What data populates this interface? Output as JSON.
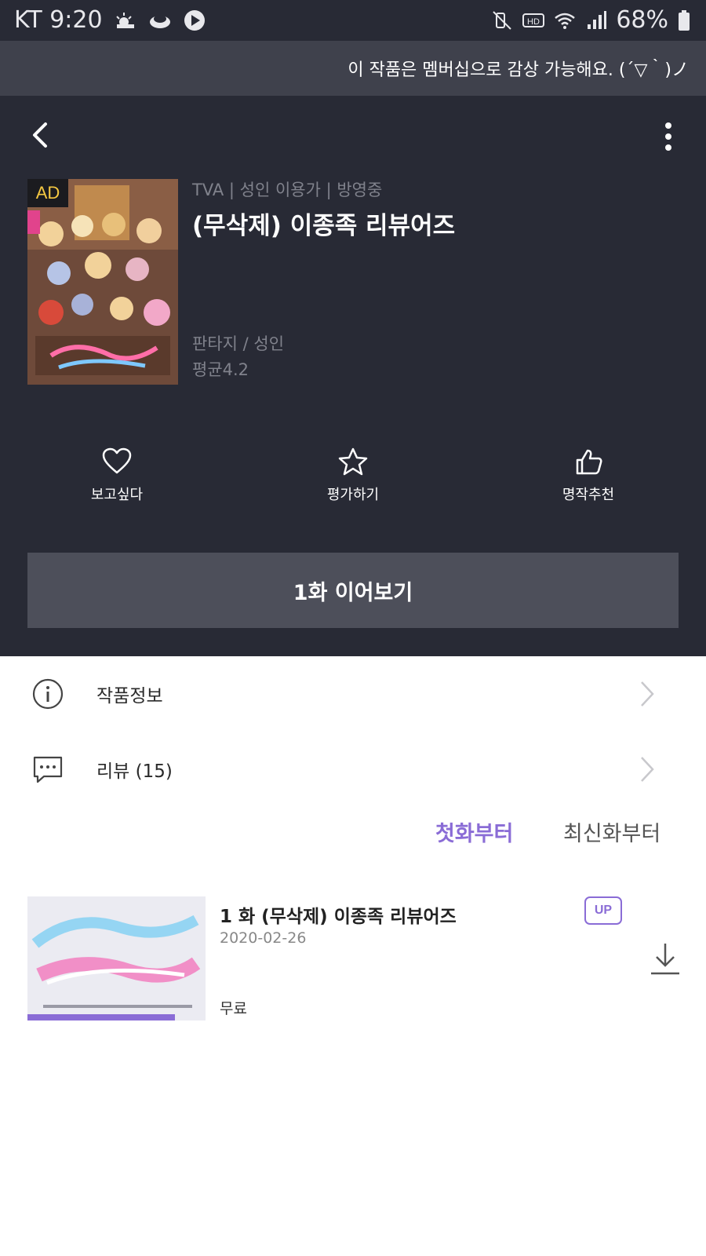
{
  "status_bar": {
    "carrier_time": "KT 9:20",
    "battery": "68%",
    "left_icons": [
      "weather-icon",
      "cloud-icon",
      "play-icon"
    ],
    "right_icons": [
      "mute-icon",
      "hd-icon",
      "wifi-icon",
      "signal-icon",
      "battery-icon"
    ]
  },
  "banner": {
    "text": "이 작품은 멤버십으로 감상 가능해요. (´▽｀)ノ"
  },
  "header": {
    "back_icon": "back-arrow-icon",
    "more_icon": "more-vert-icon"
  },
  "work": {
    "ad_badge": "AD",
    "meta": "TVA | 성인 이용가 | 방영중",
    "title": "(무삭제) 이종족 리뷰어즈",
    "genre": "판타지 / 성인",
    "rating": "평균4.2"
  },
  "actions": [
    {
      "label": "보고싶다",
      "icon": "heart-icon"
    },
    {
      "label": "평가하기",
      "icon": "star-icon"
    },
    {
      "label": "명작추천",
      "icon": "thumbs-up-icon"
    }
  ],
  "cta": {
    "label": "1화 이어보기"
  },
  "menu": [
    {
      "label": "작품정보",
      "icon": "info-icon"
    },
    {
      "label": "리뷰 (15)",
      "icon": "comment-icon"
    }
  ],
  "sort": {
    "first": "첫화부터",
    "latest": "최신화부터"
  },
  "episodes": [
    {
      "title": "1 화 (무삭제) 이종족 리뷰어즈",
      "date": "2020-02-26",
      "price": "무료",
      "badge": "UP",
      "progress": 0.83
    }
  ],
  "colors": {
    "accent": "#8a6cd6",
    "hero_bg": "#282a35",
    "cta_bg": "#4d4f5a",
    "ad_text": "#f5c842"
  }
}
